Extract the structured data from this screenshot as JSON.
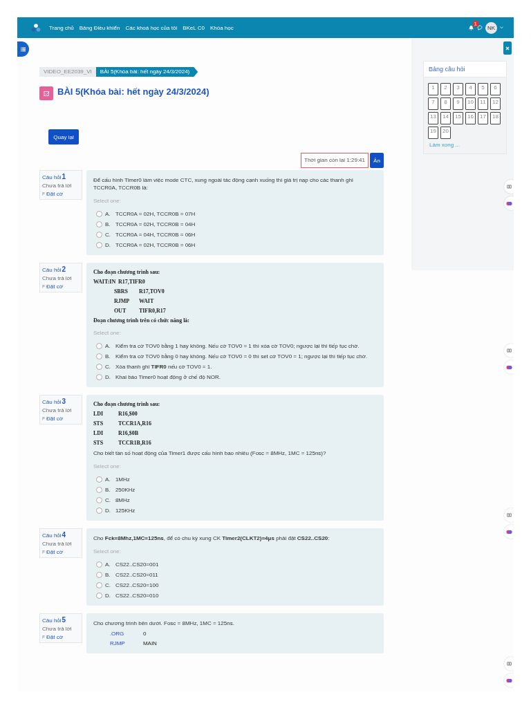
{
  "nav": {
    "links": [
      "Trang chủ",
      "Bảng Điều khiển",
      "Các khoá học của tôi",
      "BKeL C0",
      "Khóa học"
    ],
    "notification_count": "1",
    "avatar": "NK"
  },
  "drawer": {
    "title": "Bảng câu hỏi",
    "items": [
      "1",
      "2",
      "3",
      "4",
      "5",
      "6",
      "7",
      "8",
      "9",
      "10",
      "11",
      "12",
      "13",
      "14",
      "15",
      "16",
      "17",
      "18",
      "19",
      "20"
    ],
    "finish": "Làm xong ..."
  },
  "breadcrumb": [
    {
      "label": "VIDEO_EE2039_VI",
      "selected": false
    },
    {
      "label": "BÀI 5(Khóa bài: hết ngày 24/3/2024)",
      "selected": true
    }
  ],
  "title": "BÀI 5(Khóa bài: hết ngày 24/3/2024)",
  "back_button": "Quay lại",
  "timer": "Thời gian còn lại 1:29:41",
  "hide_button": "Ẩn",
  "questions": [
    {
      "label": "Câu hỏi",
      "number": "1",
      "state": "Chưa trả lời",
      "flag": "Đặt cờ",
      "body": [
        {
          "kind": "text",
          "text": "Để cấu hình Timer0 làm việc mode CTC, xung ngoài tác động cạnh xuống thì giá trị nạp cho các thanh ghi TCCR0A, TCCR0B là:"
        }
      ],
      "prompt": "Select one:",
      "options": [
        {
          "letter": "A.",
          "text": "TCCR0A = 02H, TCCR0B = 07H",
          "selected": false
        },
        {
          "letter": "B.",
          "text": "TCCR0A = 02H, TCCR0B = 04H",
          "selected": false
        },
        {
          "letter": "C.",
          "text": "TCCR0A = 04H, TCCR0B = 06H",
          "selected": false
        },
        {
          "letter": "D.",
          "text": "TCCR0A = 02H, TCCR0B = 06H",
          "selected": false
        }
      ]
    },
    {
      "label": "Câu hỏi",
      "number": "2",
      "state": "Chưa trả lời",
      "flag": "Đặt cờ",
      "body": [
        {
          "kind": "serif",
          "text": "Cho đoạn chương trình sau:"
        },
        {
          "kind": "code",
          "cells": [
            "WAIT:IN",
            "R17,TIFR0"
          ]
        },
        {
          "kind": "code",
          "indented": true,
          "cells": [
            "SBRS",
            "R17,TOV0"
          ]
        },
        {
          "kind": "code",
          "indented": true,
          "cells": [
            "RJMP",
            "WAIT"
          ]
        },
        {
          "kind": "code",
          "indented": true,
          "cells": [
            "OUT",
            "TIFR0,R17"
          ]
        },
        {
          "kind": "serif",
          "text": "Đoạn chương trình trên có chức năng là:"
        }
      ],
      "prompt": "Select one:",
      "options": [
        {
          "letter": "A.",
          "text": "Kiểm tra cờ TOV0 bằng 1 hay không. Nếu cờ TOV0 = 1 thì xóa cờ TOV0; ngược lại thì tiếp tục chờ.",
          "selected": false
        },
        {
          "letter": "B.",
          "text": "Kiểm tra cờ TOV0 bằng 0 hay không. Nếu cờ TOV0 = 0 thì set cờ TOV0 = 1; ngược lại thì tiếp tục chờ.",
          "selected": false
        },
        {
          "letter": "C.",
          "text": "Xóa thanh ghi **TIFR0** nếu cờ TOV0 = 1.",
          "selected": false
        },
        {
          "letter": "D.",
          "text": "Khai báo Timer0 hoạt động ở chế độ NOR.",
          "selected": false
        }
      ]
    },
    {
      "label": "Câu hỏi",
      "number": "3",
      "state": "Chưa trả lời",
      "flag": "Đặt cờ",
      "body": [
        {
          "kind": "serif",
          "text": "Cho đoạn chương trình sau:"
        },
        {
          "kind": "code",
          "cells": [
            "LDI",
            "R16,$00"
          ]
        },
        {
          "kind": "code",
          "cells": [
            "STS",
            "TCCR1A,R16"
          ]
        },
        {
          "kind": "code",
          "cells": [
            "LDI",
            "R16,$0B"
          ]
        },
        {
          "kind": "code",
          "cells": [
            "STS",
            "TCCR1B,R16"
          ]
        },
        {
          "kind": "text",
          "text": "Cho biết tần số hoạt động của Timer1 được cấu hình bao nhiêu (Fosc = 8MHz, 1MC = 125ns)?"
        }
      ],
      "prompt": "Select one:",
      "options": [
        {
          "letter": "A.",
          "text": "1MHz",
          "selected": false
        },
        {
          "letter": "B.",
          "text": "250KHz",
          "selected": false
        },
        {
          "letter": "C.",
          "text": "8MHz",
          "selected": false
        },
        {
          "letter": "D.",
          "text": "125KHz",
          "selected": false
        }
      ]
    },
    {
      "label": "Câu hỏi",
      "number": "4",
      "state": "Chưa trả lời",
      "flag": "Đặt cờ",
      "body": [
        {
          "kind": "text",
          "text": "Cho **Fck=8Mhz,1MC=125ns**, để có chu kỳ xung CK **Timer2(CLKT2)=4μs** phải đặt **CS22..CS20**:"
        }
      ],
      "prompt": "Select one:",
      "options": [
        {
          "letter": "A.",
          "text": "CS22..CS20=001",
          "selected": false
        },
        {
          "letter": "B.",
          "text": "CS22..CS20=011",
          "selected": false
        },
        {
          "letter": "C.",
          "text": "CS22..CS20=100",
          "selected": false
        },
        {
          "letter": "D.",
          "text": "CS22..CS20=010",
          "selected": false
        }
      ]
    },
    {
      "label": "Câu hỏi",
      "number": "5",
      "state": "Chưa trả lời",
      "flag": "Đặt cờ",
      "body": [
        {
          "kind": "text",
          "text": "Cho chương trình bên dưới. Fosc = 8MHz, 1MC = 125ns."
        },
        {
          "kind": "asm",
          "cells": [
            ".ORG",
            "0"
          ]
        },
        {
          "kind": "asm",
          "cells": [
            "RJMP",
            "MAIN"
          ]
        }
      ]
    }
  ]
}
